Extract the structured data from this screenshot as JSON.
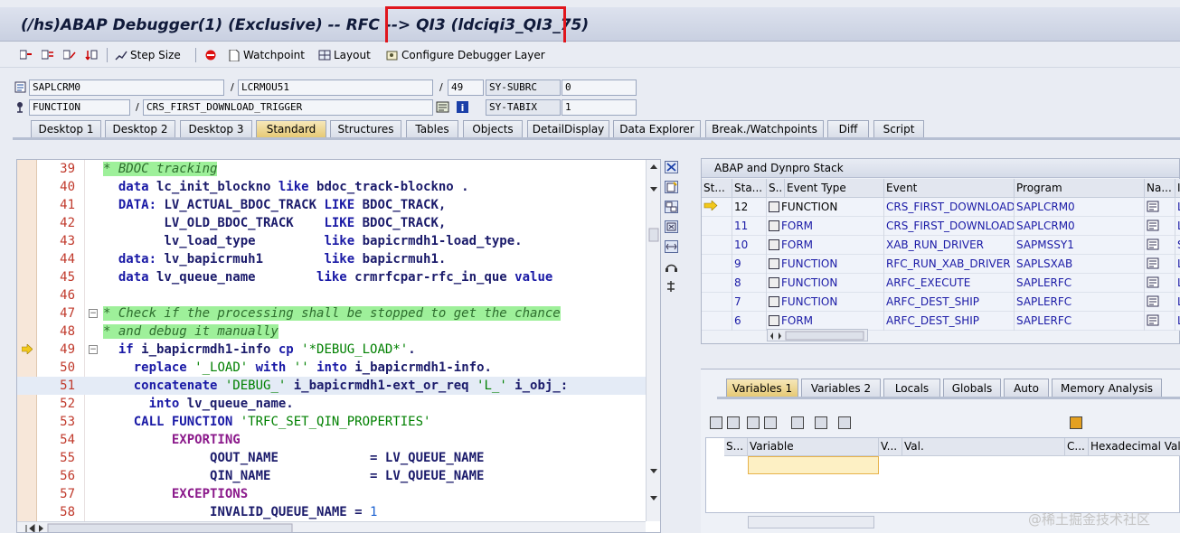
{
  "window": {
    "title_prefix": "(/hs)ABAP Debugger(1)  (Exclusive) -- RFC --> ",
    "title_target": "QI3 (ldciqi3_QI3_75)"
  },
  "toolbar": {
    "step_size": "Step Size",
    "watchpoint": "Watchpoint",
    "layout": "Layout",
    "configure": "Configure Debugger Layer"
  },
  "fields": {
    "program": "SAPLCRM0",
    "include": "LCRMOU51",
    "line": "49",
    "subrc_label": "SY-SUBRC",
    "subrc_value": "0",
    "event_type": "FUNCTION",
    "event": "CRS_FIRST_DOWNLOAD_TRIGGER",
    "tabix_label": "SY-TABIX",
    "tabix_value": "1",
    "separator": "/"
  },
  "desktop_tabs": [
    "Desktop 1",
    "Desktop 2",
    "Desktop 3",
    "Standard",
    "Structures",
    "Tables",
    "Objects",
    "DetailDisplay",
    "Data Explorer",
    "Break./Watchpoints",
    "Diff",
    "Script"
  ],
  "source": {
    "lines": [
      {
        "n": "39"
      },
      {
        "n": "40"
      },
      {
        "n": "41"
      },
      {
        "n": "42"
      },
      {
        "n": "43"
      },
      {
        "n": "44"
      },
      {
        "n": "45"
      },
      {
        "n": "46"
      },
      {
        "n": "47"
      },
      {
        "n": "48"
      },
      {
        "n": "49"
      },
      {
        "n": "50"
      },
      {
        "n": "51"
      },
      {
        "n": "52"
      },
      {
        "n": "53"
      },
      {
        "n": "54"
      },
      {
        "n": "55"
      },
      {
        "n": "56"
      },
      {
        "n": "57"
      },
      {
        "n": "58"
      }
    ],
    "text": {
      "l39": "* BDOC tracking",
      "l40a": "data",
      "l40b": " lc_init_blockno ",
      "l40c": "like",
      "l40d": " bdoc_track-blockno .",
      "l41a": "DATA:",
      "l41b": " LV_ACTUAL_BDOC_TRACK ",
      "l41c": "LIKE",
      "l41d": " BDOC_TRACK,",
      "l42a": "      LV_OLD_BDOC_TRACK    ",
      "l42b": "LIKE",
      "l42c": " BDOC_TRACK,",
      "l43a": "      lv_load_type         ",
      "l43b": "like",
      "l43c": " bapicrmdh1-load_type.",
      "l44a": "data:",
      "l44b": " lv_bapicrmuh1        ",
      "l44c": "like",
      "l44d": " bapicrmuh1.",
      "l45a": "data",
      "l45b": " lv_queue_name        ",
      "l45c": "like",
      "l45d": " crmrfcpar-rfc_in_que ",
      "l45e": "value",
      "l47": "* Check if the processing shall be stopped to get the chance",
      "l48": "* and debug it manually",
      "l49a": "if",
      "l49b": " i_bapicrmdh1-info ",
      "l49c": "cp",
      "l49d": " ",
      "l49e": "'*DEBUG_LOAD*'",
      "l49f": ".",
      "l50a": "replace",
      "l50b": " ",
      "l50c": "'_LOAD'",
      "l50d": " ",
      "l50e": "with",
      "l50f": " ",
      "l50g": "''",
      "l50h": " ",
      "l50i": "into",
      "l50j": " i_bapicrmdh1-info.",
      "l51a": "concatenate",
      "l51b": " ",
      "l51c": "'DEBUG_'",
      "l51d": " i_bapicrmdh1-ext_or_req ",
      "l51e": "'L_'",
      "l51f": " i_obj_:",
      "l52a": "into",
      "l52b": " lv_queue_name.",
      "l53a": "CALL FUNCTION",
      "l53b": " ",
      "l53c": "'TRFC_SET_QIN_PROPERTIES'",
      "l54": "EXPORTING",
      "l55a": "QOUT_NAME            ",
      "l55b": "= LV_QUEUE_NAME",
      "l56a": "QIN_NAME             ",
      "l56b": "= LV_QUEUE_NAME",
      "l57": "EXCEPTIONS",
      "l58a": "INVALID_QUEUE_NAME ",
      "l58b": "= ",
      "l58c": "1"
    }
  },
  "stack": {
    "title": "ABAP and Dynpro Stack",
    "columns": [
      "St...",
      "Sta...",
      "S..",
      "Event Type",
      "Event",
      "Program",
      "Na...",
      "I"
    ],
    "rows": [
      {
        "level": "12",
        "type": "FUNCTION",
        "event": "CRS_FIRST_DOWNLOAD...",
        "program": "SAPLCRM0",
        "incl": "L"
      },
      {
        "level": "11",
        "type": "FORM",
        "event": "CRS_FIRST_DOWNLOAD...",
        "program": "SAPLCRM0",
        "incl": "L"
      },
      {
        "level": "10",
        "type": "FORM",
        "event": "XAB_RUN_DRIVER",
        "program": "SAPMSSY1",
        "incl": "S"
      },
      {
        "level": "9",
        "type": "FUNCTION",
        "event": "RFC_RUN_XAB_DRIVER",
        "program": "SAPLSXAB",
        "incl": "L"
      },
      {
        "level": "8",
        "type": "FUNCTION",
        "event": "ARFC_EXECUTE",
        "program": "SAPLERFC",
        "incl": "L"
      },
      {
        "level": "7",
        "type": "FUNCTION",
        "event": "ARFC_DEST_SHIP",
        "program": "SAPLERFC",
        "incl": "L"
      },
      {
        "level": "6",
        "type": "FORM",
        "event": "ARFC_DEST_SHIP",
        "program": "SAPLERFC",
        "incl": "L"
      }
    ]
  },
  "variables": {
    "tabs": [
      "Variables 1",
      "Variables 2",
      "Locals",
      "Globals",
      "Auto",
      "Memory Analysis"
    ],
    "columns": [
      "S...",
      "Variable",
      "V...",
      "Val.",
      "C...",
      "Hexadecimal Value"
    ]
  },
  "watermark": "@稀土掘金技术社区"
}
